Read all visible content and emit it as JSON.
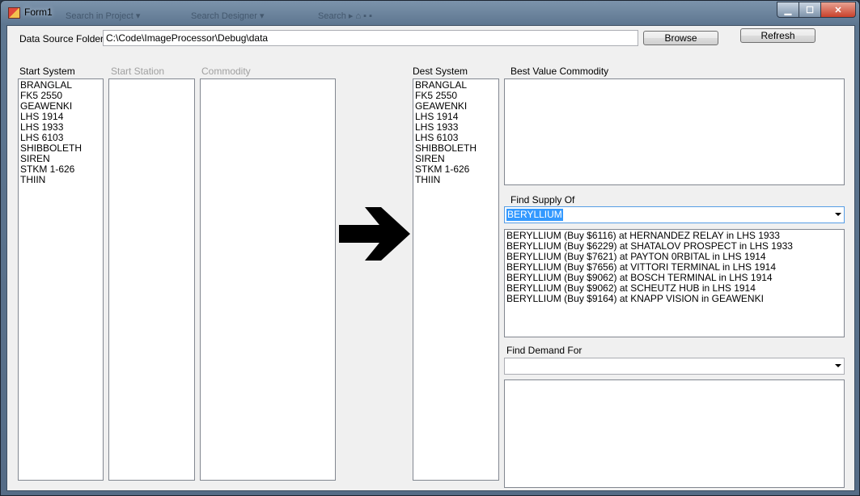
{
  "window": {
    "title": "Form1",
    "taskbar_ghosts": [
      "Search in Project ▾",
      "Search Designer ▾ ",
      "Search ▸ ⌂ ▪ ▪"
    ]
  },
  "toolbar": {
    "data_source_label": "Data Source Folder:",
    "data_source_value": "C:\\Code\\ImageProcessor\\Debug\\data",
    "browse_label": "Browse",
    "refresh_label": "Refresh"
  },
  "start_system": {
    "label": "Start System",
    "items": [
      "BRANGLAL",
      "FK5 2550",
      "GEAWENKI",
      "LHS 1914",
      "LHS 1933",
      "LHS 6103",
      "SHIBBOLETH",
      "SIREN",
      "STKM 1-626",
      "THIIN"
    ]
  },
  "start_station": {
    "label": "Start Station"
  },
  "commodity": {
    "label": "Commodity"
  },
  "dest_system": {
    "label": "Dest System",
    "items": [
      "BRANGLAL",
      "FK5 2550",
      "GEAWENKI",
      "LHS 1914",
      "LHS 1933",
      "LHS 6103",
      "SHIBBOLETH",
      "SIREN",
      "STKM 1-626",
      "THIIN"
    ]
  },
  "best_value": {
    "label": "Best Value Commodity"
  },
  "find_supply": {
    "label": "Find Supply Of",
    "selected": "BERYLLIUM",
    "results": [
      "BERYLLIUM (Buy $6116) at HERNANDEZ RELAY in LHS 1933",
      "BERYLLIUM (Buy $6229) at SHATALOV PROSPECT in LHS 1933",
      "BERYLLIUM (Buy $7621) at PAYTON 0RBITAL in LHS 1914",
      "BERYLLIUM (Buy $7656) at VITTORI TERMINAL in LHS 1914",
      "BERYLLIUM (Buy $9062) at BOSCH TERMINAL in LHS 1914",
      "BERYLLIUM (Buy $9062) at SCHEUTZ HUB in LHS 1914",
      "BERYLLIUM (Buy $9164) at KNAPP VISION in GEAWENKI"
    ]
  },
  "find_demand": {
    "label": "Find Demand For",
    "selected": ""
  },
  "colors": {
    "selection": "#3399ff",
    "disabled_text": "#a0a0a0"
  },
  "icons": {
    "route_arrow": "right-arrow-icon"
  }
}
